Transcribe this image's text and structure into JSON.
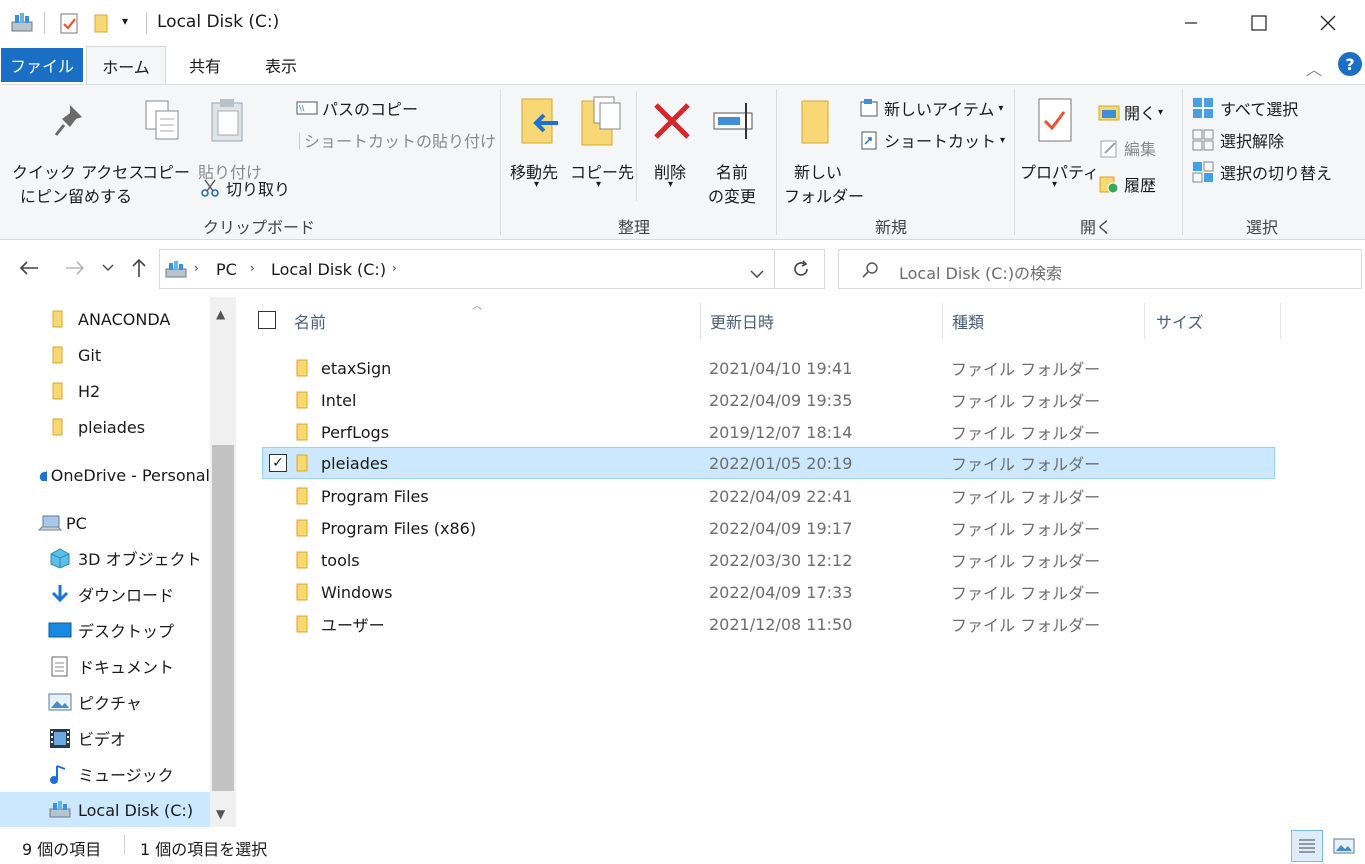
{
  "window": {
    "title": "Local Disk (C:)",
    "minimize": "—",
    "maximize": "☐",
    "close": "✕"
  },
  "tabs": [
    {
      "label": "ファイル"
    },
    {
      "label": "ホーム"
    },
    {
      "label": "共有"
    },
    {
      "label": "表示"
    }
  ],
  "ribbon": {
    "clipboard": {
      "pin_line1": "クイック アクセス",
      "pin_line2": "にピン留めする",
      "copy": "コピー",
      "paste": "貼り付け",
      "copy_path": "パスのコピー",
      "paste_shortcut": "ショートカットの貼り付け",
      "cut": "切り取り",
      "label": "クリップボード"
    },
    "organize": {
      "move_to": "移動先",
      "copy_to": "コピー先",
      "delete": "削除",
      "rename_line1": "名前",
      "rename_line2": "の変更",
      "label": "整理"
    },
    "new": {
      "new_folder_line1": "新しい",
      "new_folder_line2": "フォルダー",
      "new_item": "新しいアイテム",
      "shortcut": "ショートカット",
      "label": "新規"
    },
    "open": {
      "properties": "プロパティ",
      "open": "開く",
      "edit": "編集",
      "history": "履歴",
      "label": "開く"
    },
    "select": {
      "select_all": "すべて選択",
      "select_none": "選択解除",
      "invert": "選択の切り替え",
      "label": "選択"
    }
  },
  "address": {
    "crumbs": [
      "PC",
      "Local Disk (C:)"
    ],
    "search_placeholder": "Local Disk (C:)の検索"
  },
  "navpane": {
    "items": [
      {
        "label": "ANACONDA",
        "icon": "folder-icon"
      },
      {
        "label": "Git",
        "icon": "folder-icon"
      },
      {
        "label": "H2",
        "icon": "folder-icon"
      },
      {
        "label": "pleiades",
        "icon": "folder-icon"
      },
      {
        "label": "OneDrive - Personal",
        "icon": "onedrive-icon"
      },
      {
        "label": "PC",
        "icon": "pc-icon"
      },
      {
        "label": "3D オブジェクト",
        "icon": "cube-icon"
      },
      {
        "label": "ダウンロード",
        "icon": "download-icon"
      },
      {
        "label": "デスクトップ",
        "icon": "desktop-icon"
      },
      {
        "label": "ドキュメント",
        "icon": "document-icon"
      },
      {
        "label": "ピクチャ",
        "icon": "picture-icon"
      },
      {
        "label": "ビデオ",
        "icon": "video-icon"
      },
      {
        "label": "ミュージック",
        "icon": "music-icon"
      },
      {
        "label": "Local Disk (C:)",
        "icon": "drive-icon"
      }
    ]
  },
  "filelist": {
    "columns": [
      "名前",
      "更新日時",
      "種類",
      "サイズ"
    ],
    "rows": [
      {
        "name": "etaxSign",
        "date": "2021/04/10 19:41",
        "type": "ファイル フォルダー"
      },
      {
        "name": "Intel",
        "date": "2022/04/09 19:35",
        "type": "ファイル フォルダー"
      },
      {
        "name": "PerfLogs",
        "date": "2019/12/07 18:14",
        "type": "ファイル フォルダー"
      },
      {
        "name": "pleiades",
        "date": "2022/01/05 20:19",
        "type": "ファイル フォルダー"
      },
      {
        "name": "Program Files",
        "date": "2022/04/09 22:41",
        "type": "ファイル フォルダー"
      },
      {
        "name": "Program Files (x86)",
        "date": "2022/04/09 19:17",
        "type": "ファイル フォルダー"
      },
      {
        "name": "tools",
        "date": "2022/03/30 12:12",
        "type": "ファイル フォルダー"
      },
      {
        "name": "Windows",
        "date": "2022/04/09 17:33",
        "type": "ファイル フォルダー"
      },
      {
        "name": "ユーザー",
        "date": "2021/12/08 11:50",
        "type": "ファイル フォルダー"
      }
    ]
  },
  "status": {
    "item_count": "9 個の項目",
    "selected_count": "1 個の項目を選択"
  },
  "colors": {
    "accent": "#1a6fc4",
    "selection": "#cce8ff",
    "folder": "#f8d775"
  }
}
